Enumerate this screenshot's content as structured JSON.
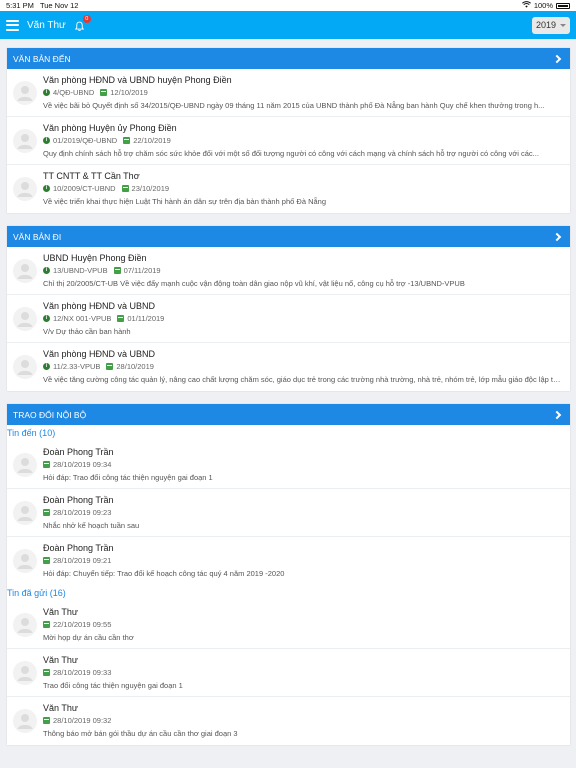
{
  "status_bar": {
    "time": "5:31 PM",
    "date": "Tue Nov 12",
    "battery": "100%"
  },
  "app_bar": {
    "user": "Văn Thư",
    "notification_count": "0",
    "year": "2019"
  },
  "incoming": {
    "title": "VĂN BẢN ĐẾN",
    "items": [
      {
        "title": "Văn phòng HĐND và UBND huyện Phong Điền",
        "number": "4/QĐ-UBND",
        "date": "12/10/2019",
        "desc": "Về việc bãi bỏ Quyết định số 34/2015/QĐ-UBND ngày 09 tháng 11 năm 2015 của UBND thành phố Đà Nẵng ban hành Quy chế khen thưởng trong h..."
      },
      {
        "title": "Văn phòng Huyện ủy Phong Điền",
        "number": "01/2019/QĐ-UBND",
        "date": "22/10/2019",
        "desc": "Quy định chính sách hỗ trợ chăm sóc sức khỏe đối với một số đối tượng người có công với cách mạng và chính sách hỗ trợ người có công với các..."
      },
      {
        "title": "TT CNTT & TT Cần Thơ",
        "number": "10/2009/CT-UBND",
        "date": "23/10/2019",
        "desc": "Về việc triển khai thực hiện Luật Thi hành án dân sự trên địa bàn thành phố Đà Nẵng"
      }
    ]
  },
  "outgoing": {
    "title": "VĂN BẢN ĐI",
    "items": [
      {
        "title": "UBND Huyện Phong Điền",
        "number": "13/UBND-VPUB",
        "date": "07/11/2019",
        "desc": "Chỉ thị 20/2005/CT-UB Về việc đẩy mạnh cuộc vận động toàn dân giao nộp vũ khí, vật liệu nổ, công cụ hỗ trợ -13/UBND-VPUB"
      },
      {
        "title": "Văn phòng HĐND và UBND",
        "number": "12/NX 001-VPUB",
        "date": "01/11/2019",
        "desc": "V/v Dự thảo cần ban hành"
      },
      {
        "title": "Văn phòng HĐND và UBND",
        "number": "11/2.33-VPUB",
        "date": "28/10/2019",
        "desc": "Về việc tăng cường công tác quản lý, nâng cao chất lượng chăm sóc, giáo dục trẻ trong các trường nhà trường, nhà trẻ, nhóm trẻ, lớp mẫu giáo độc lập tư ..."
      }
    ]
  },
  "exchange": {
    "title": "TRAO ĐỔI NỘI BỘ",
    "received_label": "Tin đến (10)",
    "received": [
      {
        "title": "Đoàn Phong Trần",
        "date": "28/10/2019 09:34",
        "desc": "Hỏi đáp: Trao đổi công tác thiện nguyện gai đoạn 1"
      },
      {
        "title": "Đoàn Phong Trần",
        "date": "28/10/2019 09:23",
        "desc": "Nhắc nhở kế hoạch tuần sau"
      },
      {
        "title": "Đoàn Phong Trần",
        "date": "28/10/2019 09:21",
        "desc": "Hỏi đáp: Chuyển tiếp: Trao đổi kế hoạch công tác quý 4 năm 2019 -2020"
      }
    ],
    "sent_label": "Tin đã gửi (16)",
    "sent": [
      {
        "title": "Văn Thư",
        "date": "22/10/2019 09:55",
        "desc": "Mời họp dự án cầu cần thơ"
      },
      {
        "title": "Văn Thư",
        "date": "28/10/2019 09:33",
        "desc": "Trao đổi công tác thiện nguyện gai đoạn 1"
      },
      {
        "title": "Văn Thư",
        "date": "28/10/2019 09:32",
        "desc": "Thông báo mở bán gói thầu dự án cầu cần thơ giai đoạn 3"
      }
    ]
  }
}
